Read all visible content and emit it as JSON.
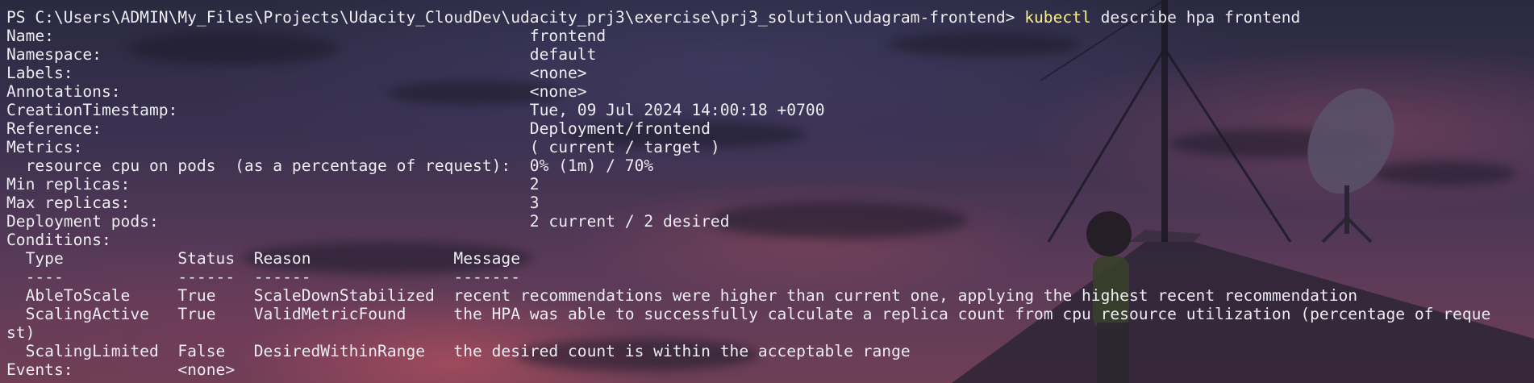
{
  "terminal": {
    "prompt": "PS C:\\Users\\ADMIN\\My_Files\\Projects\\Udacity_CloudDev\\udacity_prj3\\exercise\\prj3_solution\\udagram-frontend> ",
    "command": "kubectl",
    "args": " describe hpa frontend",
    "output_lines": [
      "Name:                                                  frontend",
      "Namespace:                                             default",
      "Labels:                                                <none>",
      "Annotations:                                           <none>",
      "CreationTimestamp:                                     Tue, 09 Jul 2024 14:00:18 +0700",
      "Reference:                                             Deployment/frontend",
      "Metrics:                                               ( current / target )",
      "  resource cpu on pods  (as a percentage of request):  0% (1m) / 70%",
      "Min replicas:                                          2",
      "Max replicas:                                          3",
      "Deployment pods:                                       2 current / 2 desired",
      "Conditions:",
      "  Type            Status  Reason               Message",
      "  ----            ------  ------               -------",
      "  AbleToScale     True    ScaleDownStabilized  recent recommendations were higher than current one, applying the highest recent recommendation",
      "  ScalingActive   True    ValidMetricFound     the HPA was able to successfully calculate a replica count from cpu resource utilization (percentage of reque",
      "st)",
      "  ScalingLimited  False   DesiredWithinRange   the desired count is within the acceptable range",
      "Events:           <none>"
    ]
  },
  "colors": {
    "text": "#ececf1",
    "command": "#f6f08a"
  }
}
